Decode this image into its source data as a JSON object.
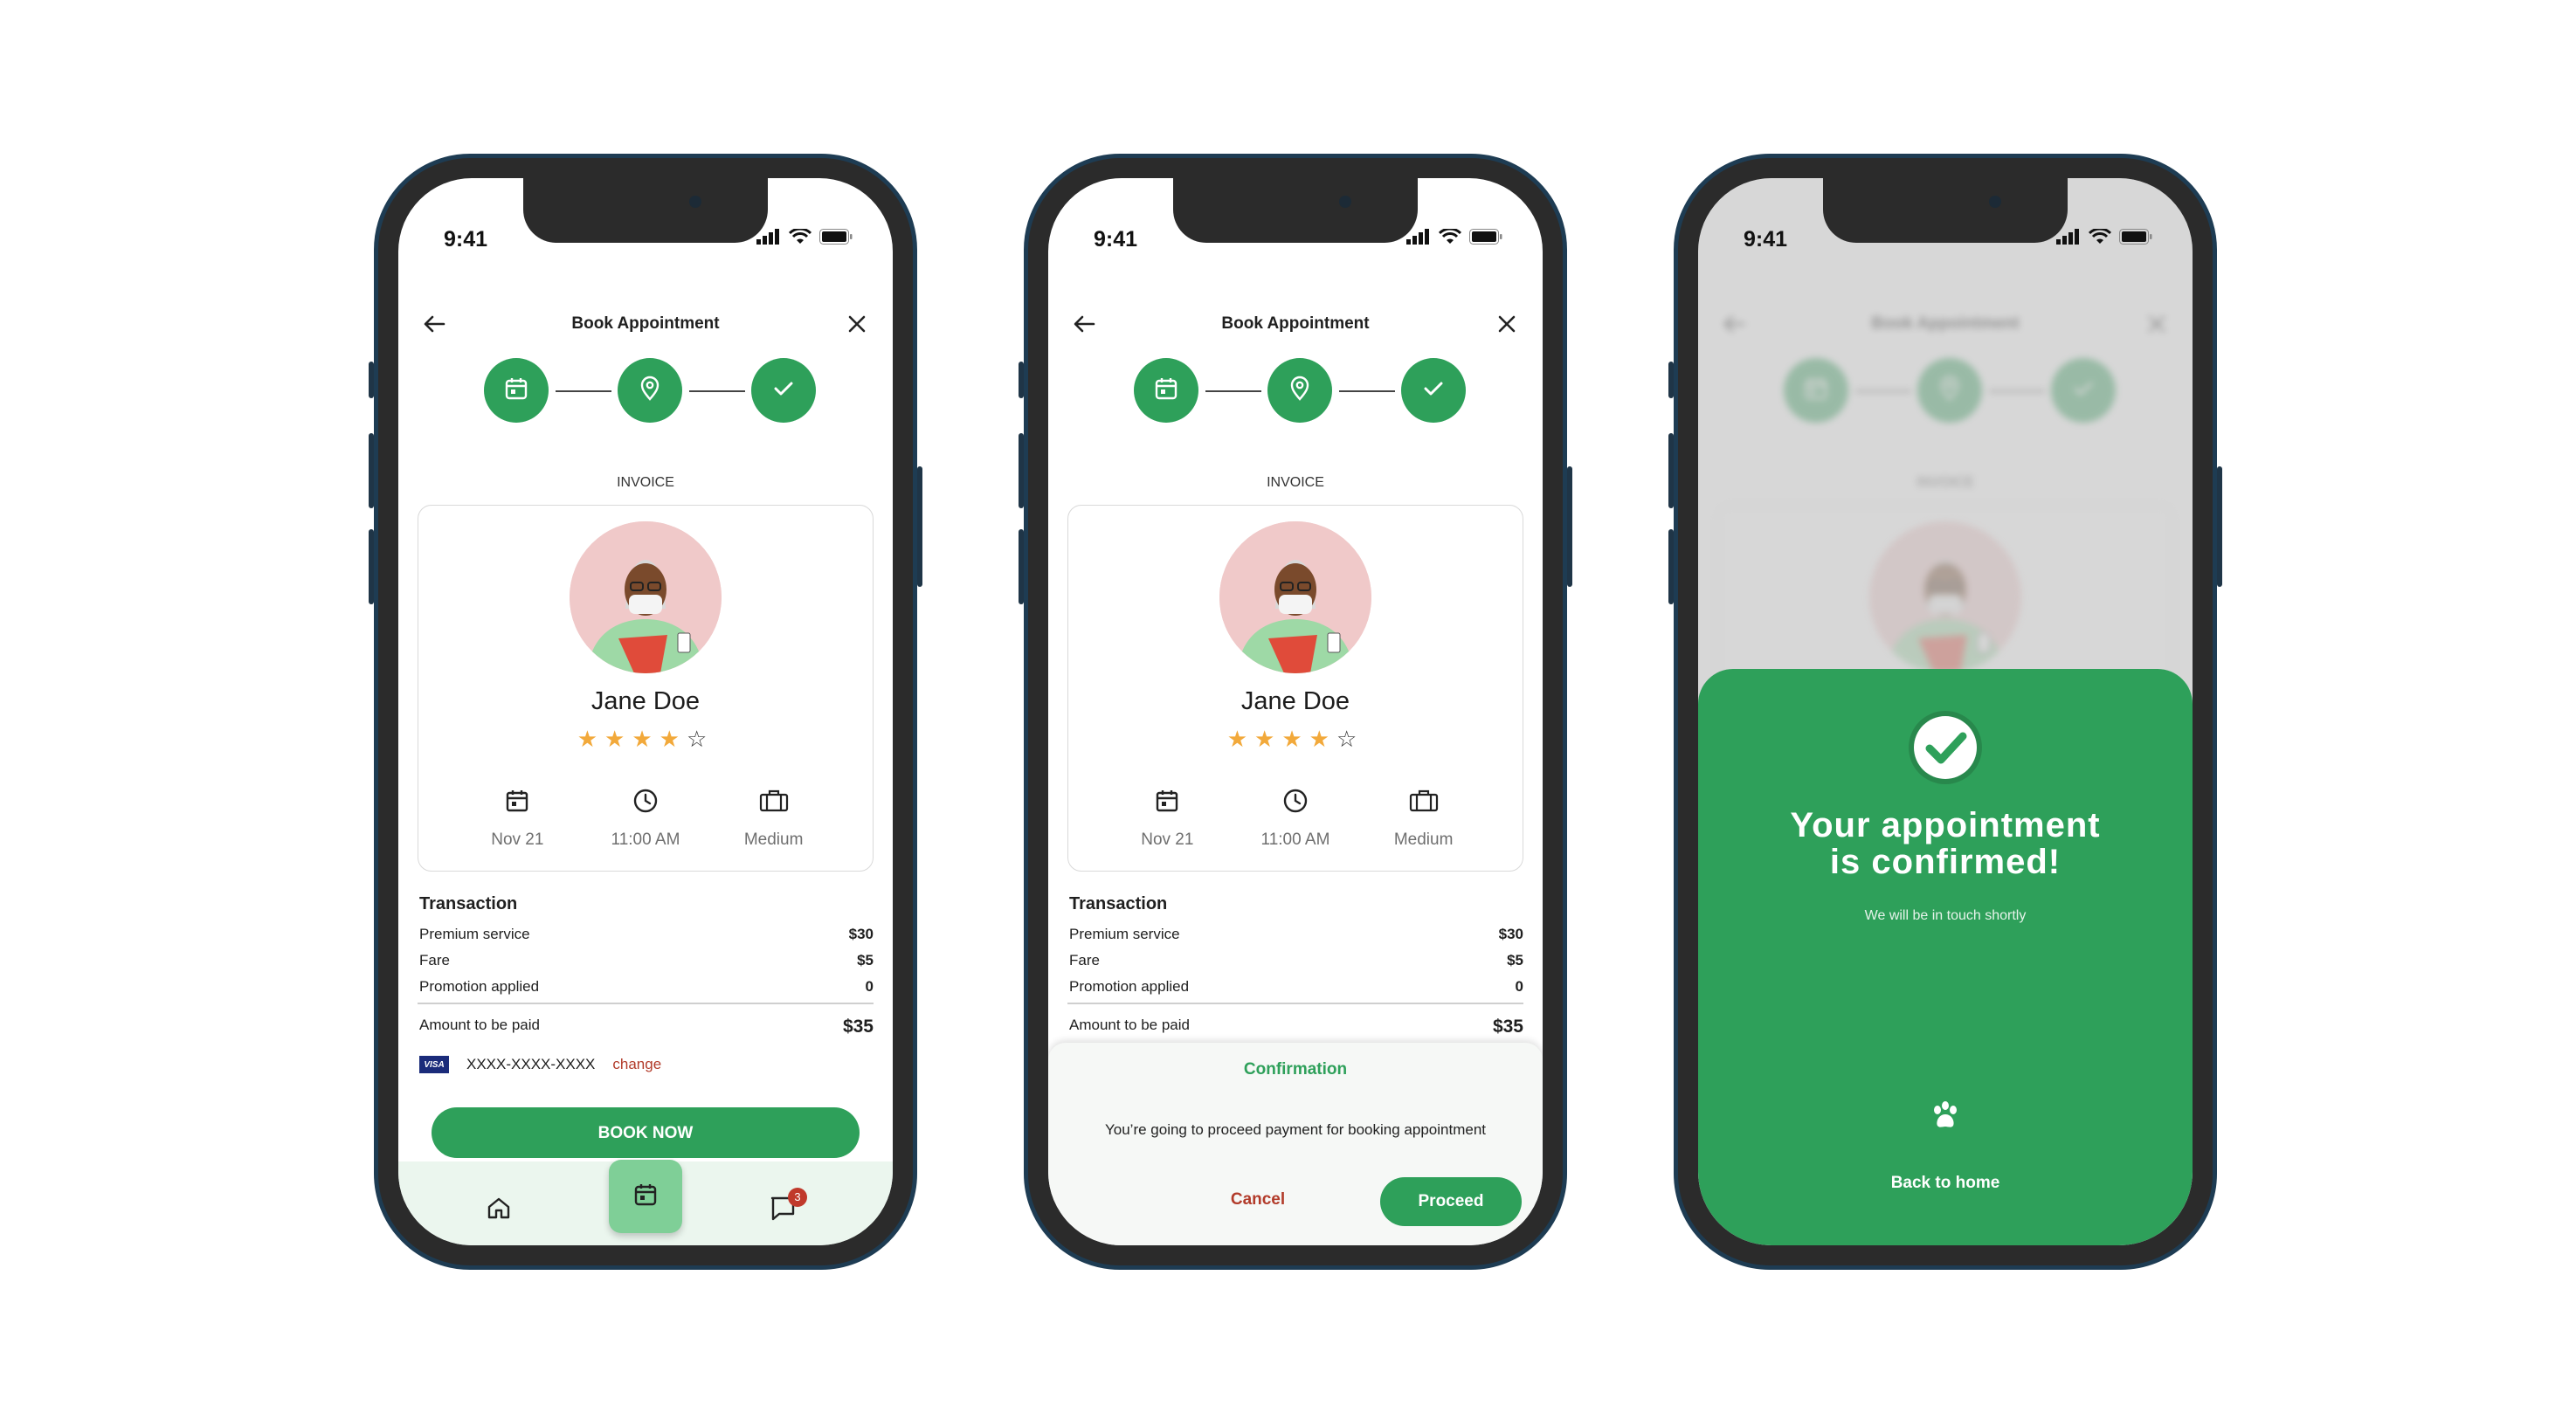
{
  "status_time": "9:41",
  "header": {
    "title": "Book Appointment"
  },
  "invoice_label": "INVOICE",
  "doctor": {
    "name": "Jane Doe",
    "rating": 4,
    "max_rating": 5
  },
  "appointment": {
    "date": "Nov 21",
    "time": "11:00 AM",
    "size": "Medium"
  },
  "transaction": {
    "title": "Transaction",
    "rows": [
      {
        "label": "Premium service",
        "value": "$30"
      },
      {
        "label": "Fare",
        "value": "$5"
      },
      {
        "label": "Promotion applied",
        "value": "0"
      }
    ],
    "total_label": "Amount to be paid",
    "total_value": "$35",
    "card_brand": "VISA",
    "card_number": "XXXX-XXXX-XXXX",
    "change_label": "change"
  },
  "book_button": "BOOK NOW",
  "nav": {
    "messages_badge": "3"
  },
  "dialog": {
    "title": "Confirmation",
    "message": "You’re going to proceed payment for booking appointment",
    "cancel": "Cancel",
    "proceed": "Proceed"
  },
  "success": {
    "headline_line1": "Your appointment",
    "headline_line2": "is confirmed!",
    "subtitle": "We will be in touch shortly",
    "back_home": "Back to home"
  },
  "colors": {
    "accent": "#2ea05a",
    "star": "#f2a93b",
    "danger": "#b23b2a",
    "frame": "#1e3c53"
  }
}
